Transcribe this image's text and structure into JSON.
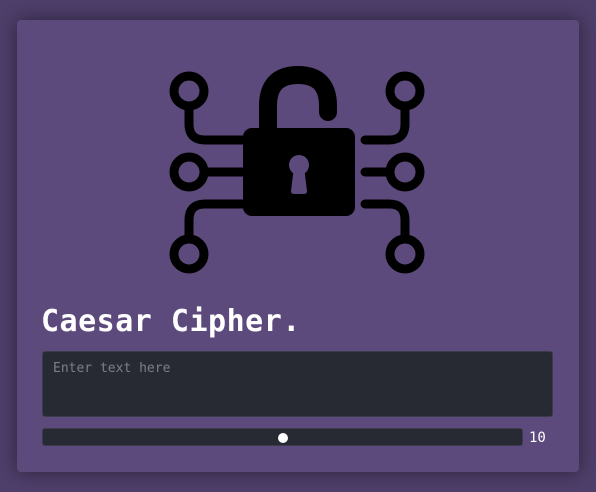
{
  "app": {
    "title": "Caesar Cipher.",
    "logo_icon": "unlocked-padlock-circuit-icon"
  },
  "input": {
    "placeholder": "Enter text here",
    "value": ""
  },
  "shift": {
    "value": 10,
    "min": 0,
    "max": 20,
    "display": "10"
  },
  "colors": {
    "background": "#4e3e6a",
    "card": "#5d4a7c",
    "field": "#282a33",
    "text": "#ffffff"
  }
}
